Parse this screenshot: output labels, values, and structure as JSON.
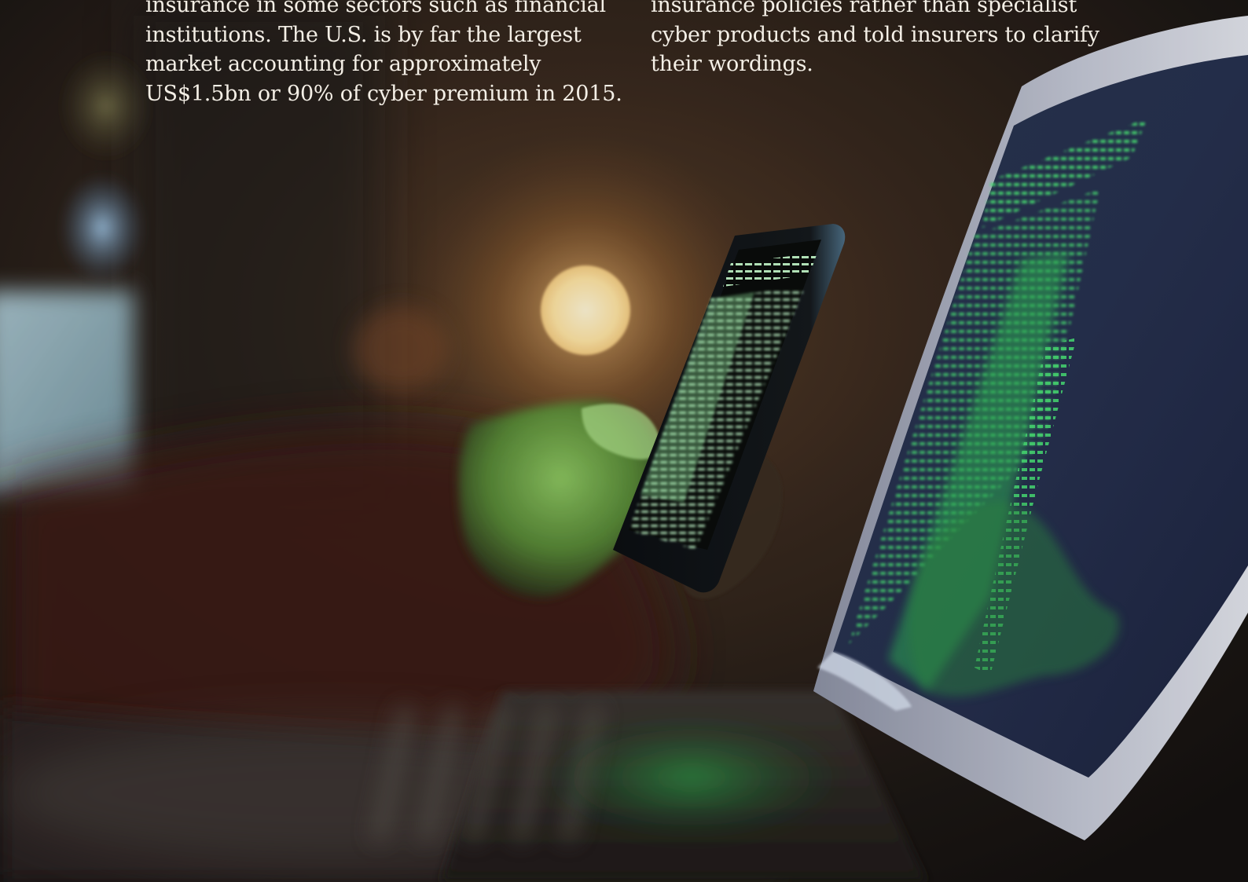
{
  "columns": {
    "left": {
      "lines": [
        "insurance in some sectors such as financial",
        "institutions. The U.S. is by far the largest",
        "market accounting for approximately",
        "US$1.5bn or 90% of cyber premium in 2015."
      ]
    },
    "right": {
      "lines": [
        "insurance policies rather than specialist",
        "cyber products and told insurers to clarify",
        "their wordings."
      ]
    }
  },
  "photo": {
    "subject": "hands holding smartphone beside laptop screen with green code",
    "palette": {
      "background": "#1b1612",
      "screen_green": "#3fe06a",
      "bokeh_light": "#fff1c4",
      "laptop_frame": "#c9ccd6"
    }
  }
}
